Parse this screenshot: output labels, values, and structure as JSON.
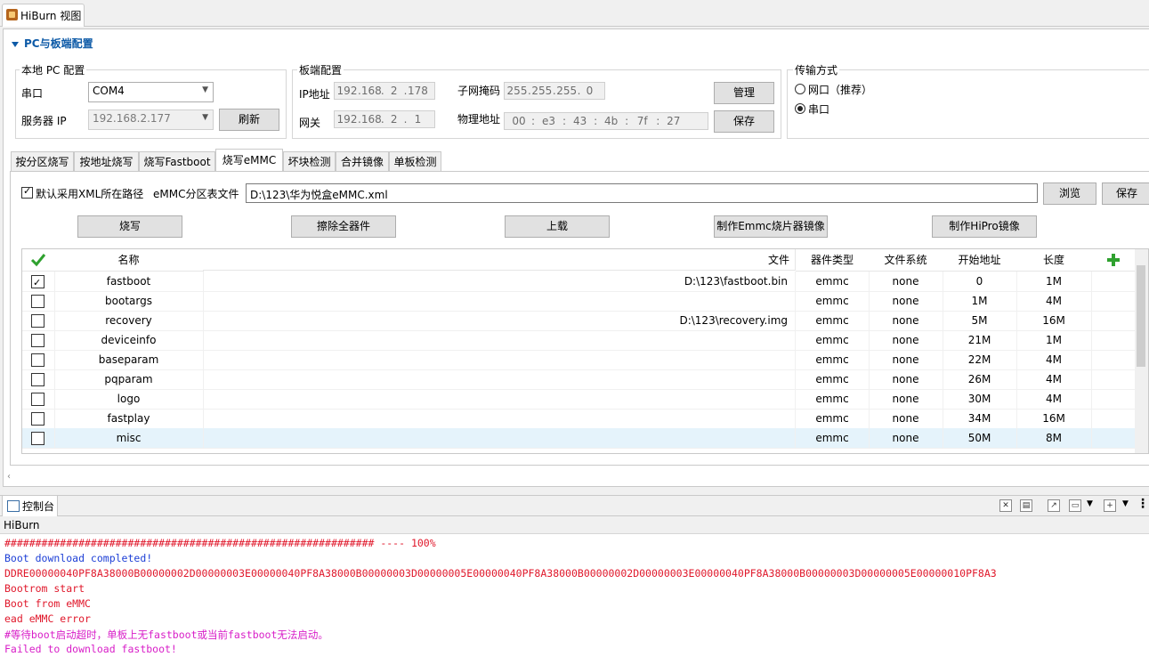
{
  "view_tab": {
    "title": "HiBurn 视图"
  },
  "section": {
    "title": "PC与板端配置"
  },
  "local_pc": {
    "title": "本地 PC 配置",
    "serial_label": "串口",
    "serial_value": "COM4",
    "server_ip_label": "服务器 IP",
    "server_ip_value": "192.168.2.177",
    "refresh_button": "刷新"
  },
  "board": {
    "title": "板端配置",
    "ip_label": "IP地址",
    "ip": [
      "192",
      "168",
      "2",
      "178"
    ],
    "gateway_label": "网关",
    "gateway": [
      "192",
      "168",
      "2",
      "1"
    ],
    "mask_label": "子网掩码",
    "mask": [
      "255",
      "255",
      "255",
      "0"
    ],
    "mac_label": "物理地址",
    "mac": [
      "00",
      "e3",
      "43",
      "4b",
      "7f",
      "27"
    ],
    "manage_button": "管理",
    "save_button": "保存"
  },
  "transfer": {
    "title": "传输方式",
    "options": [
      {
        "label": "网口（推荐）",
        "selected": false
      },
      {
        "label": "串口",
        "selected": true
      }
    ]
  },
  "tabs": [
    "按分区烧写",
    "按地址烧写",
    "烧写Fastboot",
    "烧写eMMC",
    "坏块检测",
    "合并镜像",
    "单板检测"
  ],
  "active_tab": "烧写eMMC",
  "emmc": {
    "default_xml_label": "默认采用XML所在路径",
    "default_xml_checked": true,
    "table_file_label": "eMMC分区表文件",
    "table_file_value": "D:\\123\\华为悦盒eMMC.xml",
    "browse_button": "浏览",
    "save_button": "保存",
    "burn_button": "烧写",
    "erase_button": "擦除全器件",
    "upload_button": "上载",
    "make_emmc_button": "制作Emmc烧片器镜像",
    "make_hipro_button": "制作HiPro镜像"
  },
  "table": {
    "headers": [
      "名称",
      "文件",
      "器件类型",
      "文件系统",
      "开始地址",
      "长度"
    ],
    "rows": [
      {
        "checked": true,
        "name": "fastboot",
        "file": "D:\\123\\fastboot.bin",
        "type": "emmc",
        "fs": "none",
        "start": "0",
        "length": "1M"
      },
      {
        "checked": false,
        "name": "bootargs",
        "file": "",
        "type": "emmc",
        "fs": "none",
        "start": "1M",
        "length": "4M"
      },
      {
        "checked": false,
        "name": "recovery",
        "file": "D:\\123\\recovery.img",
        "type": "emmc",
        "fs": "none",
        "start": "5M",
        "length": "16M"
      },
      {
        "checked": false,
        "name": "deviceinfo",
        "file": "",
        "type": "emmc",
        "fs": "none",
        "start": "21M",
        "length": "1M"
      },
      {
        "checked": false,
        "name": "baseparam",
        "file": "",
        "type": "emmc",
        "fs": "none",
        "start": "22M",
        "length": "4M"
      },
      {
        "checked": false,
        "name": "pqparam",
        "file": "",
        "type": "emmc",
        "fs": "none",
        "start": "26M",
        "length": "4M"
      },
      {
        "checked": false,
        "name": "logo",
        "file": "",
        "type": "emmc",
        "fs": "none",
        "start": "30M",
        "length": "4M"
      },
      {
        "checked": false,
        "name": "fastplay",
        "file": "",
        "type": "emmc",
        "fs": "none",
        "start": "34M",
        "length": "16M"
      },
      {
        "checked": false,
        "name": "misc",
        "file": "",
        "type": "emmc",
        "fs": "none",
        "start": "50M",
        "length": "8M"
      }
    ]
  },
  "console": {
    "tab_title": "控制台",
    "title": "HiBurn",
    "lines": [
      {
        "text": "############################################################ ---- 100%",
        "color": "#e0182b"
      },
      {
        "text": "Boot download completed!",
        "color": "#1d3fd6"
      },
      {
        "text": "DDRE00000040PF8A38000B00000002D00000003E00000040PF8A38000B00000003D00000005E00000040PF8A38000B00000002D00000003E00000040PF8A38000B00000003D00000005E00000010PF8A3",
        "color": "#e0182b"
      },
      {
        "text": "Bootrom start",
        "color": "#e0182b"
      },
      {
        "text": "Boot from eMMC",
        "color": "#e0182b"
      },
      {
        "text": "ead eMMC error",
        "color": "#e0182b"
      },
      {
        "text": "#等待boot启动超时，单板上无fastboot或当前fastboot无法启动。",
        "color": "#d81ec8"
      },
      {
        "text": "Failed to download fastboot!",
        "color": "#d81ec8"
      }
    ]
  }
}
